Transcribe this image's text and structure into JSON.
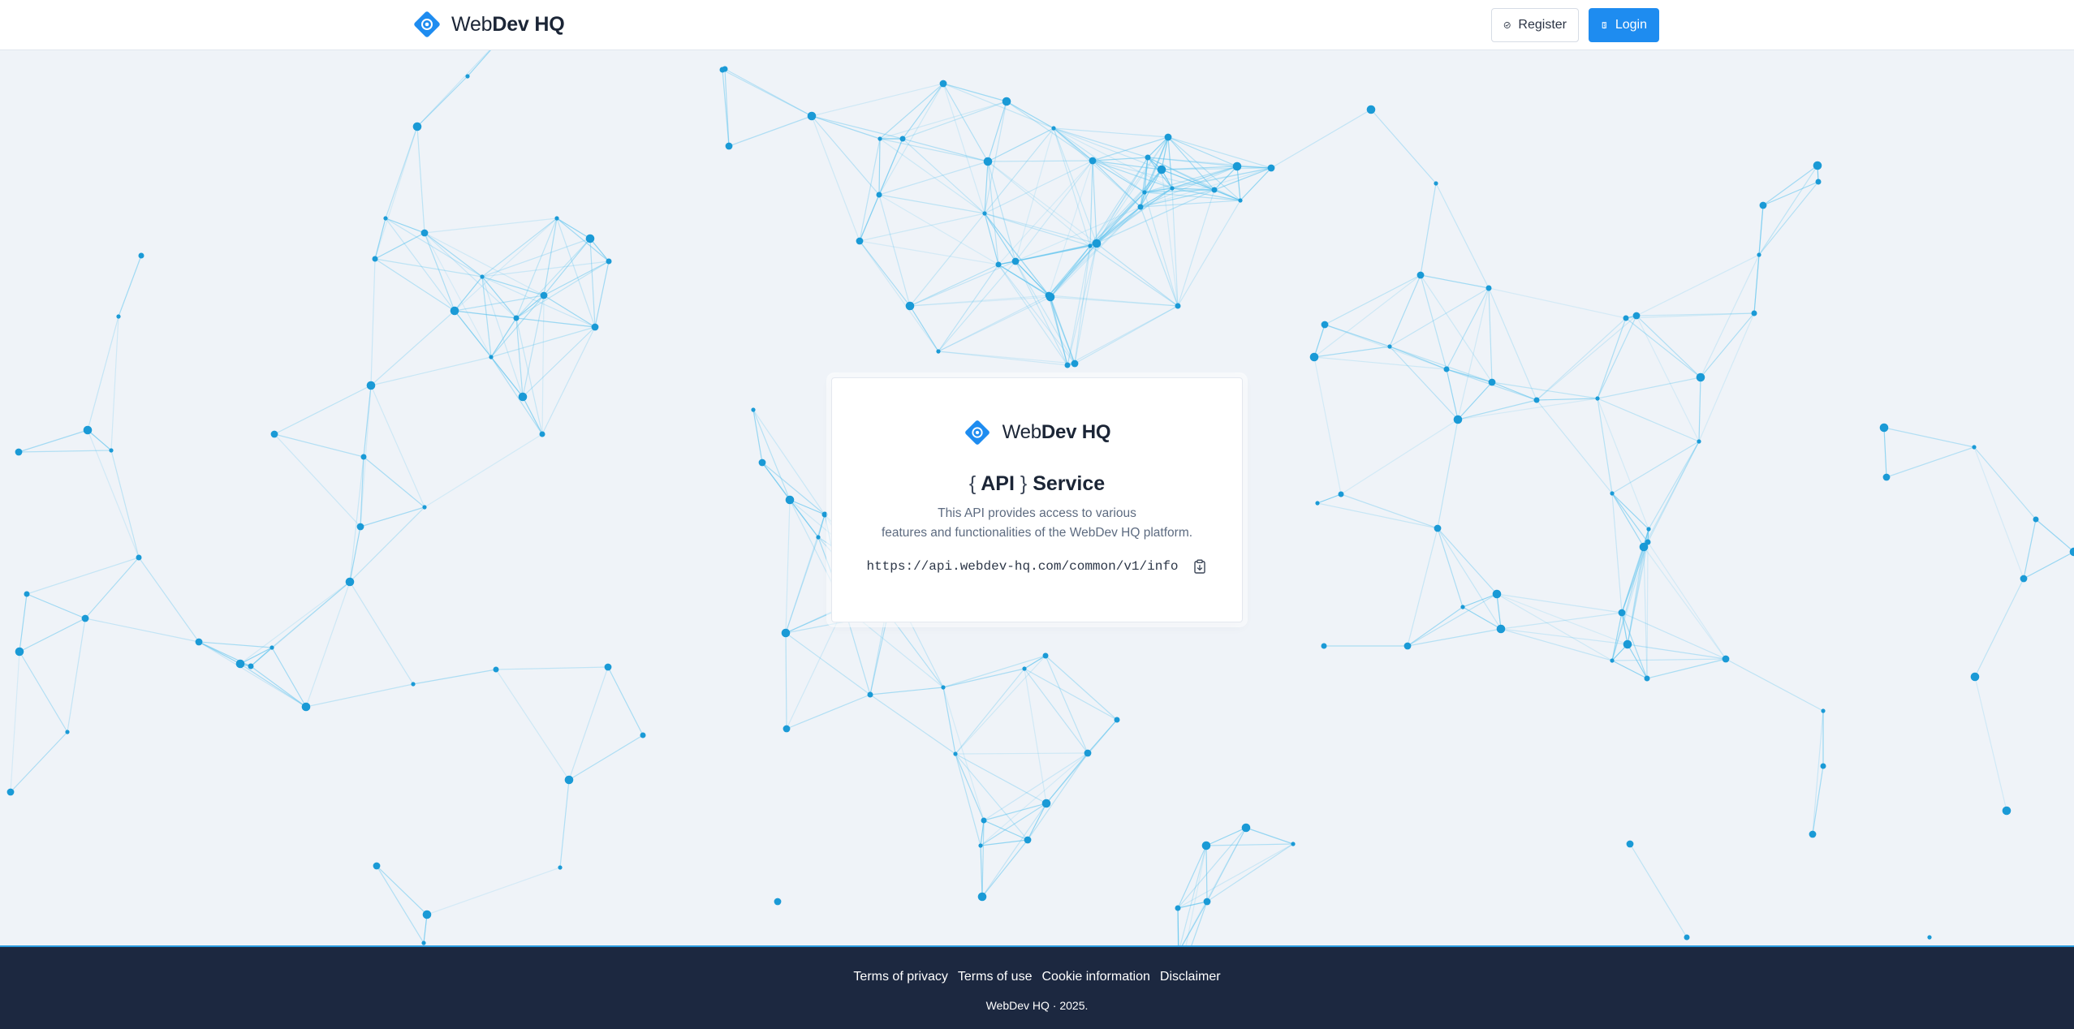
{
  "navbar": {
    "brand_light": "Web",
    "brand_bold": "Dev HQ",
    "logo_icon": "webdev-diamond-logo-icon",
    "register_label": "Register",
    "register_icon": "check-circle-icon",
    "login_label": "Login",
    "login_icon": "door-icon"
  },
  "card": {
    "brand_light": "Web",
    "brand_bold": "Dev HQ",
    "title_open": "{",
    "title_text": "API",
    "title_close": "}",
    "title_suffix": "Service",
    "description_line1": "This API provides access to various",
    "description_line2": "features and functionalities of the WebDev HQ platform.",
    "url": "https://api.webdev-hq.com/common/v1/info",
    "copy_icon": "clipboard-icon"
  },
  "footer": {
    "links": [
      "Terms of privacy",
      "Terms of use",
      "Cookie information",
      "Disclaimer"
    ],
    "copyright": "WebDev HQ · 2025."
  },
  "colors": {
    "accent": "#1e8cf0",
    "node": "#1a9ad6",
    "edge": "#5cc3ee",
    "page_background": "#eff3f8",
    "footer_background": "#1c2840"
  }
}
